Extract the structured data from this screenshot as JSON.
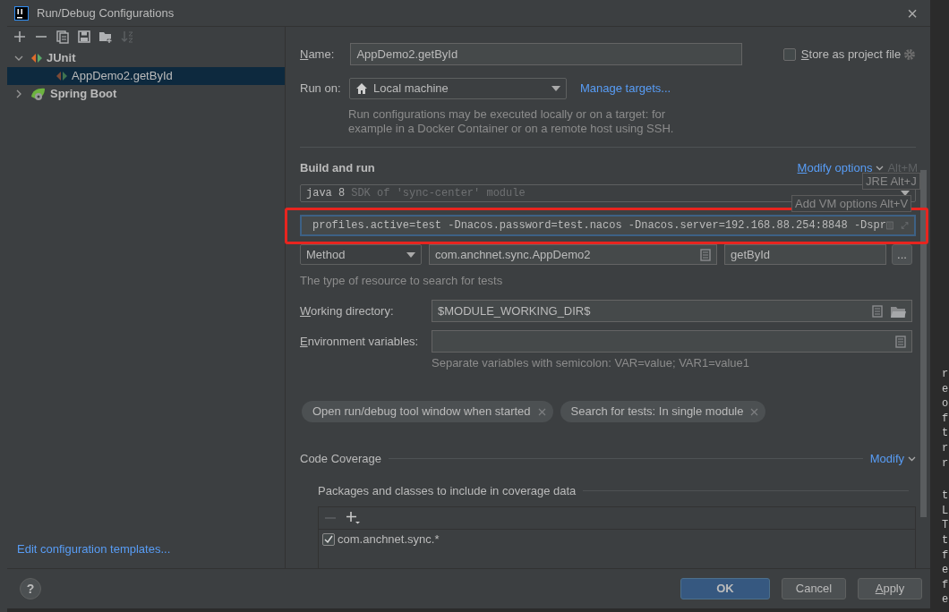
{
  "window": {
    "title": "Run/Debug Configurations",
    "close": "×"
  },
  "toolbar": [
    {
      "kind": "add",
      "disabled": false
    },
    {
      "kind": "remove",
      "disabled": false
    },
    {
      "kind": "copy",
      "disabled": false
    },
    {
      "kind": "save",
      "disabled": false
    },
    {
      "kind": "folder",
      "disabled": false
    },
    {
      "kind": "sort",
      "disabled": true
    }
  ],
  "tree": [
    {
      "label": "JUnit",
      "kind": "junit",
      "expanded": true,
      "selected": false,
      "children": [
        {
          "label": "AppDemo2.getById",
          "kind": "test",
          "selected": true
        }
      ]
    },
    {
      "label": "Spring Boot",
      "kind": "spring",
      "expanded": false,
      "selected": false
    }
  ],
  "templates_link": "Edit configuration templates...",
  "name": {
    "label": "Name:",
    "underline_first": true,
    "value": "AppDemo2.getById"
  },
  "store_as_project_file": {
    "label": "Store as project file",
    "underline_first": true,
    "checked": false
  },
  "run_on": {
    "label": "Run on:",
    "value": "Local machine",
    "link": "Manage targets...",
    "hint": "Run configurations may be executed locally or on a target: for\nexample in a Docker Container or on a remote host using SSH."
  },
  "build_and_run": {
    "title": "Build and run",
    "modify_options": "Modify options",
    "modify_underline_first": true,
    "shortcut": "Alt+M",
    "jre": {
      "version": "java 8",
      "detail": "SDK of 'sync-center' module"
    },
    "vm_options": {
      "value": "profiles.active=test -Dnacos.password=test.nacos -Dnacos.server=192.168.88.254:8848 -Dspr",
      "focused": true,
      "highlighted": true
    },
    "test_kind": "Method",
    "class": "com.anchnet.sync.AppDemo2",
    "method": "getById",
    "more": "...",
    "hint": "The type of resource to search for tests"
  },
  "tooltips": [
    {
      "text": "JRE Alt+J"
    },
    {
      "text": "Add VM options Alt+V"
    }
  ],
  "working_directory": {
    "label": "Working directory:",
    "underline_first": true,
    "value": "$MODULE_WORKING_DIR$"
  },
  "environment_variables": {
    "label": "Environment variables:",
    "underline_first": true,
    "hint": "Separate variables with semicolon: VAR=value; VAR1=value1"
  },
  "chips": [
    {
      "label": "Open run/debug tool window when started"
    },
    {
      "label": "Search for tests: In single module"
    }
  ],
  "code_coverage": {
    "title": "Code Coverage",
    "modify": "Modify",
    "packages_title": "Packages and classes to include in coverage data",
    "patterns": [
      {
        "label": "com.anchnet.sync.*",
        "checked": true
      }
    ]
  },
  "buttons": [
    {
      "label": "OK",
      "kind": "primary",
      "underline_first": false
    },
    {
      "label": "Cancel",
      "kind": "default",
      "underline_first": false
    },
    {
      "label": "Apply",
      "kind": "default",
      "underline_first": true
    }
  ],
  "help": "?",
  "background_code_fragments": [
    "r",
    "e",
    "o",
    "f",
    "t",
    "r",
    "r",
    "t",
    "L",
    "T",
    "t",
    "f",
    "e",
    "f",
    "e"
  ]
}
